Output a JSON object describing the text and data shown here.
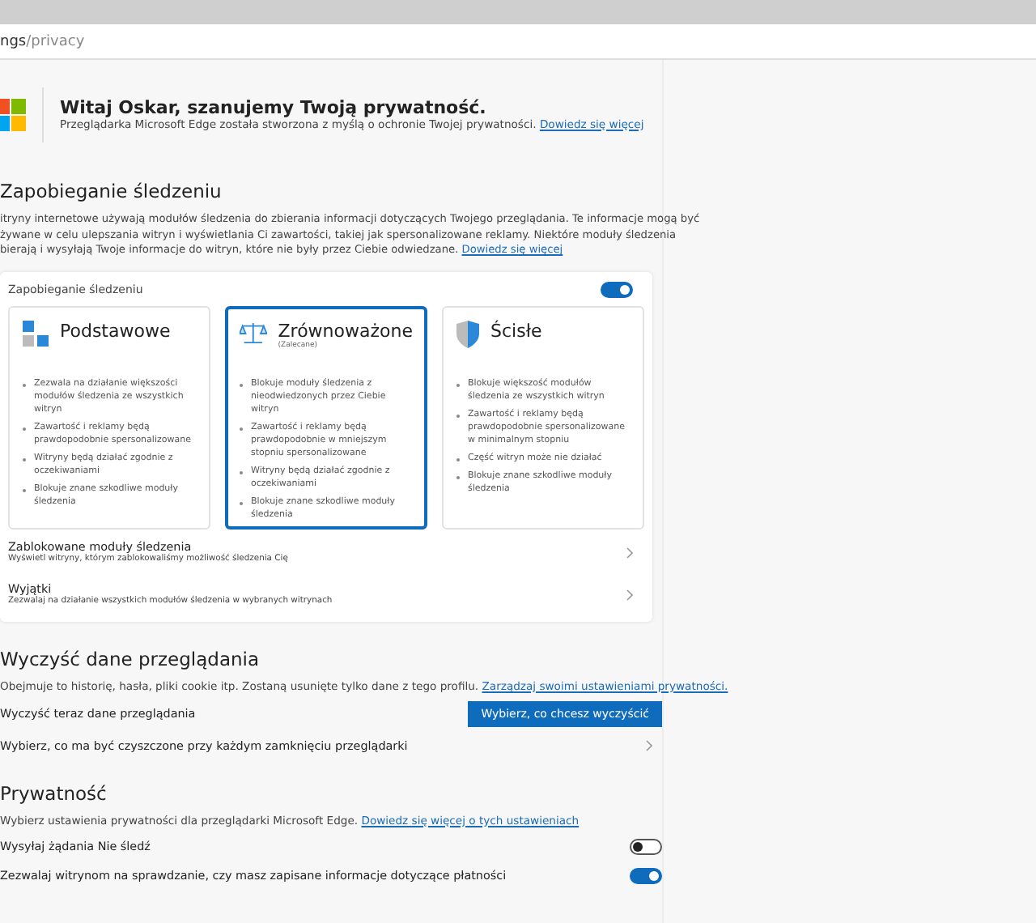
{
  "address": {
    "host_part": "ngs",
    "path": "/privacy"
  },
  "welcome": {
    "title": "Witaj Oskar, szanujemy Twoją prywatność.",
    "text": "Przeglądarka Microsoft Edge została stworzona z myślą o ochronie Twojej prywatności.",
    "link": "Dowiedz się więcej"
  },
  "tracking": {
    "heading": "Zapobieganie śledzeniu",
    "description": [
      "itryny internetowe używają modułów śledzenia do zbierania informacji dotyczących Twojego przeglądania. Te informacje mogą być",
      "żywane w celu ulepszania witryn i wyświetlania Ci zawartości, takiej jak spersonalizowane reklamy. Niektóre moduły śledzenia",
      "bierają i wysyłają Twoje informacje do witryn, które nie były przez Ciebie odwiedzane."
    ],
    "link": "Dowiedz się więcej",
    "toggle": {
      "label": "Zapobieganie śledzeniu",
      "on": true
    },
    "options": [
      {
        "kind": "basic",
        "title": "Podstawowe",
        "selected": false,
        "bullets": [
          "Zezwala na działanie większości modułów śledzenia ze wszystkich witryn",
          "Zawartość i reklamy będą prawdopodobnie spersonalizowane",
          "Witryny będą działać zgodnie z oczekiwaniami",
          "Blokuje znane szkodliwe moduły śledzenia"
        ]
      },
      {
        "kind": "balanced",
        "title": "Zrównoważone",
        "subtitle": "(Zalecane)",
        "selected": true,
        "bullets": [
          "Blokuje moduły śledzenia z nieodwiedzonych przez Ciebie witryn",
          "Zawartość i reklamy będą prawdopodobnie w mniejszym stopniu spersonalizowane",
          "Witryny będą działać zgodnie z oczekiwaniami",
          "Blokuje znane szkodliwe moduły śledzenia"
        ]
      },
      {
        "kind": "strict",
        "title": "Ścisłe",
        "selected": false,
        "bullets": [
          "Blokuje większość modułów śledzenia ze wszystkich witryn",
          "Zawartość i reklamy będą prawdopodobnie spersonalizowane w minimalnym stopniu",
          "Część witryn może nie działać",
          "Blokuje znane szkodliwe moduły śledzenia"
        ]
      }
    ],
    "rows": [
      {
        "title": "Zablokowane moduły śledzenia",
        "subtitle": "Wyświetl witryny, którym zablokowaliśmy możliwość śledzenia Cię"
      },
      {
        "title": "Wyjątki",
        "subtitle": "Zezwalaj na działanie wszystkich modułów śledzenia w wybranych witrynach"
      }
    ]
  },
  "clear": {
    "heading": "Wyczyść dane przeglądania",
    "description": "Obejmuje to historię, hasła, pliki cookie itp. Zostaną usunięte tylko dane z tego profilu.",
    "link": "Zarządzaj swoimi ustawieniami prywatności.",
    "action_row": {
      "label": "Wyczyść teraz dane przeglądania",
      "button": "Wybierz, co chcesz wyczyścić"
    },
    "row": {
      "label": "Wybierz, co ma być czyszczone przy każdym zamknięciu przeglądarki"
    }
  },
  "privacy": {
    "heading": "Prywatność",
    "description": "Wybierz ustawienia prywatności dla przeglądarki Microsoft Edge.",
    "link": "Dowiedz się więcej o tych ustawieniach",
    "toggles": [
      {
        "label": "Wysyłaj żądania Nie śledź",
        "on": false
      },
      {
        "label": "Zezwalaj witrynom na sprawdzanie, czy masz zapisane informacje dotyczące płatności",
        "on": true
      }
    ]
  }
}
